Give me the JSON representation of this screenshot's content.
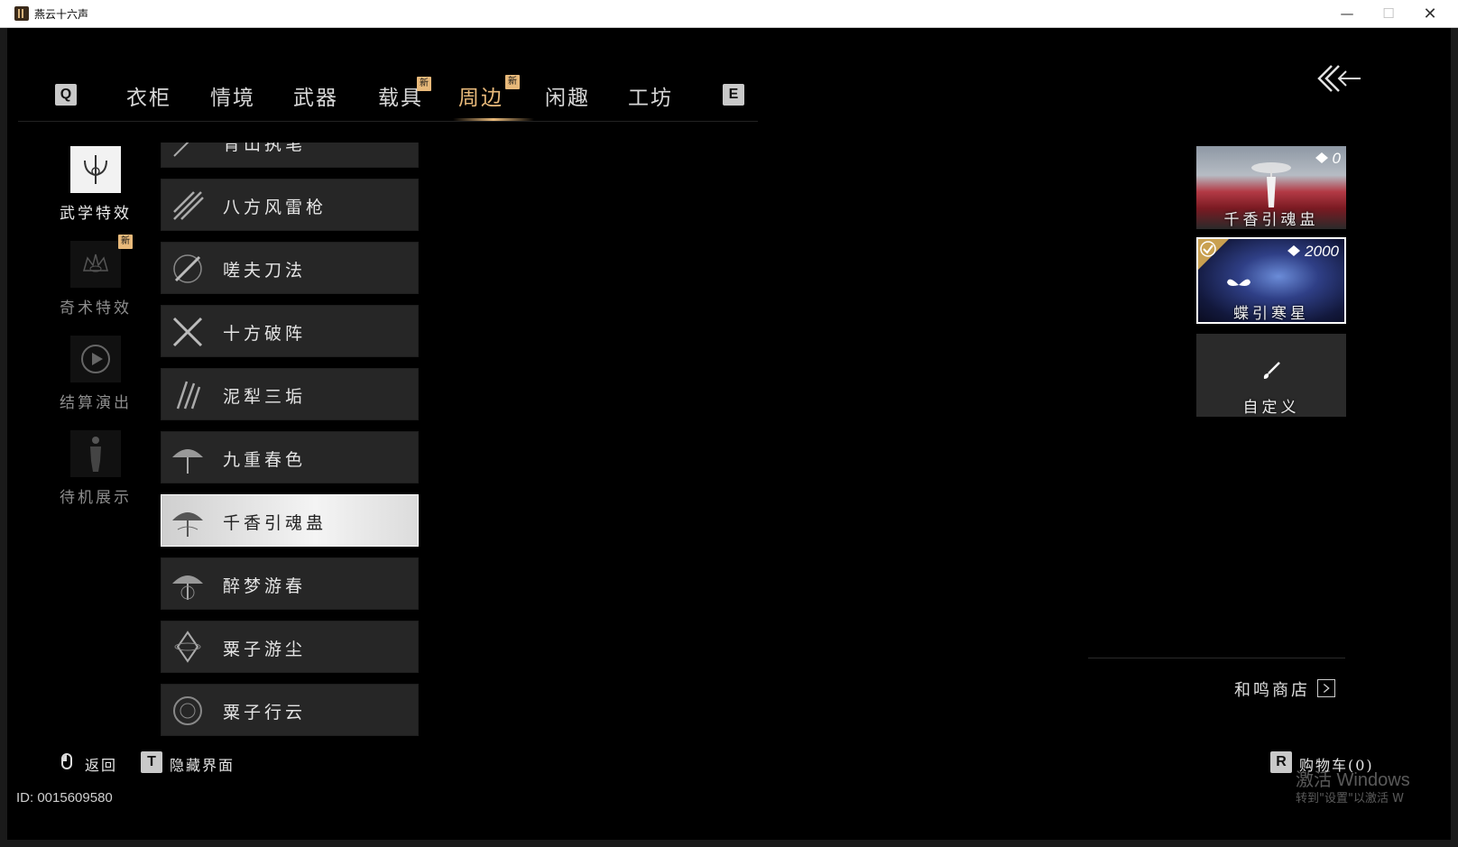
{
  "window": {
    "title": "燕云十六声"
  },
  "nav": {
    "key_left": "Q",
    "key_right": "E",
    "tabs": [
      {
        "label": "衣柜"
      },
      {
        "label": "情境"
      },
      {
        "label": "武器"
      },
      {
        "label": "载具",
        "badge": "新"
      },
      {
        "label": "周边",
        "badge": "新",
        "active": true
      },
      {
        "label": "闲趣"
      },
      {
        "label": "工坊"
      }
    ]
  },
  "categories": [
    {
      "label": "武学特效",
      "icon": "trident-icon",
      "active": true
    },
    {
      "label": "奇术特效",
      "icon": "crown-eye-icon",
      "badge": "新"
    },
    {
      "label": "结算演出",
      "icon": "play-icon"
    },
    {
      "label": "待机展示",
      "icon": "figure-icon"
    }
  ],
  "list": {
    "items": [
      {
        "label": "青山执笔",
        "icon": "brush-feather-icon"
      },
      {
        "label": "八方风雷枪",
        "icon": "spear-icon"
      },
      {
        "label": "嗟夫刀法",
        "icon": "blade-icon"
      },
      {
        "label": "十方破阵",
        "icon": "crossed-blades-icon"
      },
      {
        "label": "泥犁三垢",
        "icon": "claw-icon"
      },
      {
        "label": "九重春色",
        "icon": "umbrella-icon"
      },
      {
        "label": "千香引魂蛊",
        "icon": "umbrella-icon",
        "selected": true
      },
      {
        "label": "醉梦游春",
        "icon": "umbrella-icon"
      },
      {
        "label": "粟子游尘",
        "icon": "spinning-top-icon"
      },
      {
        "label": "粟子行云",
        "icon": "swirl-icon"
      }
    ]
  },
  "variants": [
    {
      "name": "千香引魂盅",
      "price": "0"
    },
    {
      "name": "蝶引寒星",
      "price": "2000",
      "selected": true
    },
    {
      "name": "自定义",
      "icon": "brush-icon"
    }
  ],
  "shop": {
    "label": "和鸣商店"
  },
  "bottom": {
    "back_label": "返回",
    "hide_key": "T",
    "hide_label": "隐藏界面",
    "cart_key": "R",
    "cart_label": "购物车(0)",
    "user_id": "ID: 0015609580"
  },
  "watermark": {
    "line1": "激活 Windows",
    "line2": "转到\"设置\"以激活 W"
  },
  "colors": {
    "accent": "#e8b97a",
    "background": "#000000",
    "item_bg": "#262626"
  }
}
